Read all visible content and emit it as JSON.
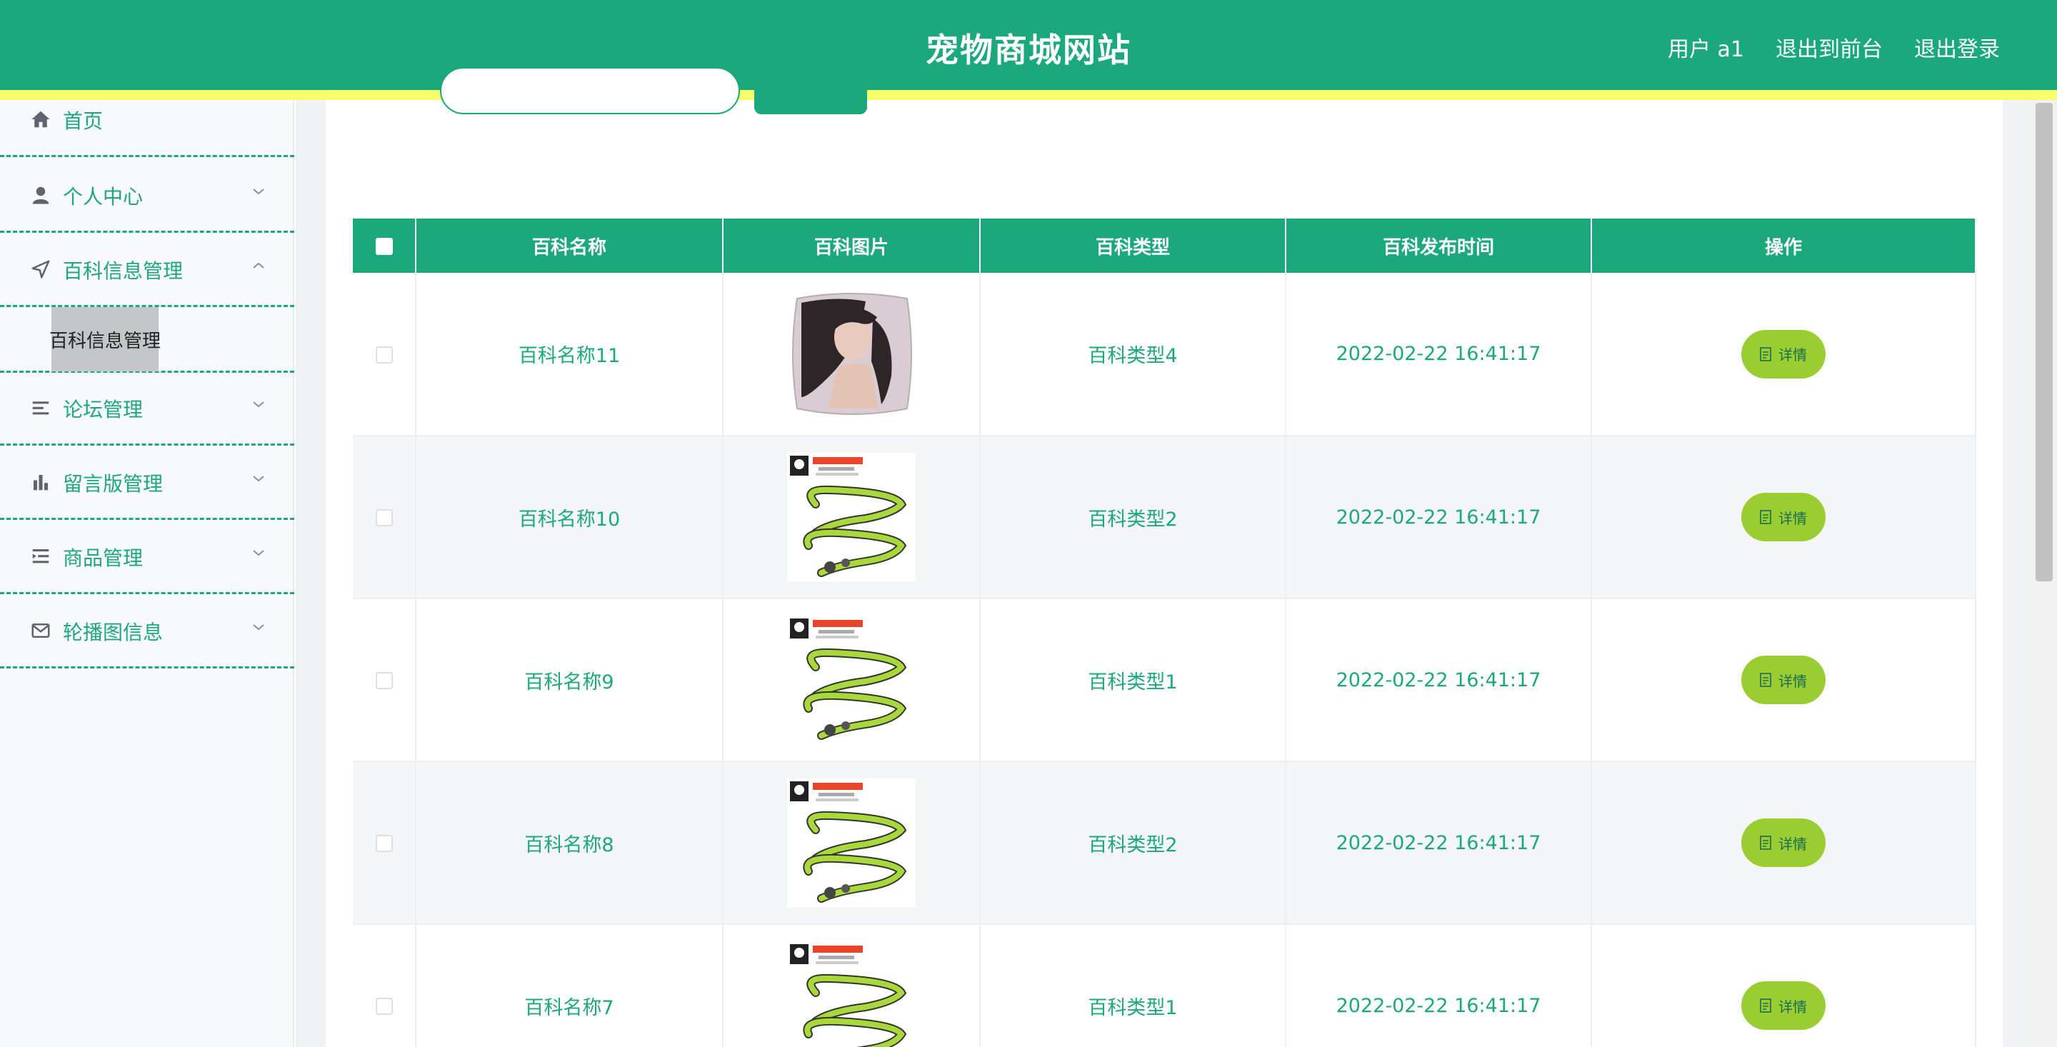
{
  "header": {
    "site_title": "宠物商城网站",
    "user_label": "用户 a1",
    "front_label": "退出到前台",
    "logout_label": "退出登录"
  },
  "sidebar": {
    "items": [
      {
        "label": "首页",
        "icon": "home-icon"
      },
      {
        "label": "个人中心",
        "icon": "user-icon"
      },
      {
        "label": "百科信息管理",
        "icon": "send-icon"
      },
      {
        "label": "论坛管理",
        "icon": "list-icon"
      },
      {
        "label": "留言版管理",
        "icon": "bar-chart-icon"
      },
      {
        "label": "商品管理",
        "icon": "indent-icon"
      },
      {
        "label": "轮播图信息",
        "icon": "mail-icon"
      }
    ],
    "submenu_label": "百科信息管理"
  },
  "table": {
    "columns": [
      "百科名称",
      "百科图片",
      "百科类型",
      "百科发布时间",
      "操作"
    ],
    "detail_label": "详情",
    "rows": [
      {
        "name": "百科名称11",
        "image": "pillow-portrait",
        "type": "百科类型4",
        "time": "2022-02-22 16:41:17"
      },
      {
        "name": "百科名称10",
        "image": "pet-leash",
        "type": "百科类型2",
        "time": "2022-02-22 16:41:17"
      },
      {
        "name": "百科名称9",
        "image": "pet-leash",
        "type": "百科类型1",
        "time": "2022-02-22 16:41:17"
      },
      {
        "name": "百科名称8",
        "image": "pet-leash",
        "type": "百科类型2",
        "time": "2022-02-22 16:41:17"
      },
      {
        "name": "百科名称7",
        "image": "pet-leash",
        "type": "百科类型1",
        "time": "2022-02-22 16:41:17"
      }
    ]
  },
  "colors": {
    "primary": "#1ba97b",
    "accent_stripe": "#f6fd6a",
    "detail_button": "#9acd32"
  }
}
